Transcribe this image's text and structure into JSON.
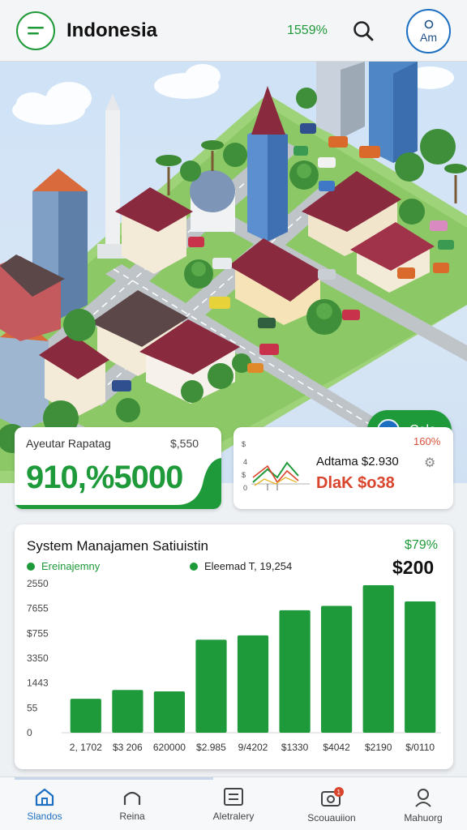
{
  "header": {
    "title": "Indonesia",
    "stat": "1559%",
    "avatar_text": "Am",
    "menu_icon": "menu-icon",
    "search_icon": "search-icon"
  },
  "scene": {
    "action_button_label": "Cola"
  },
  "card_left": {
    "label": "Ayeutar Rapatag",
    "amount": "$,550",
    "value": "910,%5000"
  },
  "card_right": {
    "percent": "160%",
    "line1": "Adtama $2.930",
    "line2": "DlaK $o38",
    "mini_ticks": [
      "$",
      "4",
      "$",
      "0"
    ]
  },
  "chart": {
    "title": "System Manajamen Satiuistin",
    "percent": "$79%",
    "legend_a": "Ereinajemny",
    "legend_b": "Eleemad T, 19,254",
    "total": "$200",
    "colors": {
      "bar": "#1f9a3a"
    },
    "y_ticks": [
      "2550",
      "7655",
      "$755",
      "3350",
      "1443",
      "55",
      "0"
    ]
  },
  "chart_data": {
    "type": "bar",
    "categories": [
      "2, 1702",
      "$3 206",
      "620000",
      "$2.985",
      "9/4202",
      "$1330",
      "$4042",
      "$2190",
      "$/0110"
    ],
    "values": [
      0.23,
      0.29,
      0.28,
      0.63,
      0.66,
      0.83,
      0.86,
      1.0,
      0.89
    ],
    "title": "System Manajamen Satiuistin",
    "xlabel": "",
    "ylabel": "",
    "grid": false,
    "legend": "top-left"
  },
  "nav": {
    "items": [
      {
        "label": "Slandos",
        "icon": "home-icon"
      },
      {
        "label": "Reina",
        "icon": "arch-icon"
      },
      {
        "label": "Aletralery",
        "icon": "list-icon"
      },
      {
        "label": "Scouauiion",
        "icon": "camera-icon",
        "badge": "1"
      },
      {
        "label": "Mahuorg",
        "icon": "user-icon"
      }
    ]
  }
}
